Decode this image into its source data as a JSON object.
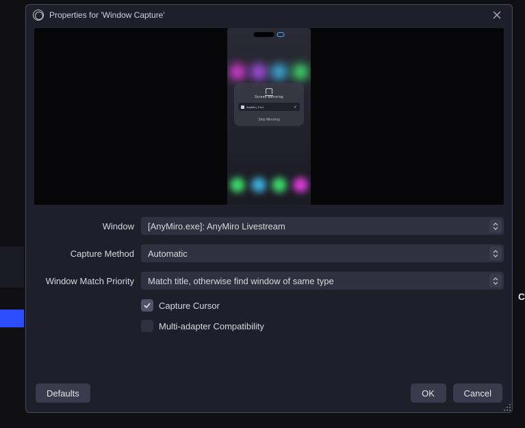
{
  "title": "Properties for 'Window Capture'",
  "preview": {
    "card_title": "Screen Mirroring",
    "card_row_text": "AnyMiro_Pro1",
    "card_bottom": "Stop Mirroring"
  },
  "form": {
    "window": {
      "label": "Window",
      "value": "[AnyMiro.exe]: AnyMiro Livestream"
    },
    "capture_method": {
      "label": "Capture Method",
      "value": "Automatic"
    },
    "match_priority": {
      "label": "Window Match Priority",
      "value": "Match title, otherwise find window of same type"
    },
    "capture_cursor": {
      "label": "Capture Cursor",
      "checked": true
    },
    "multi_adapter": {
      "label": "Multi-adapter Compatibility",
      "checked": false
    }
  },
  "buttons": {
    "defaults": "Defaults",
    "ok": "OK",
    "cancel": "Cancel"
  },
  "bg_peek": "C"
}
